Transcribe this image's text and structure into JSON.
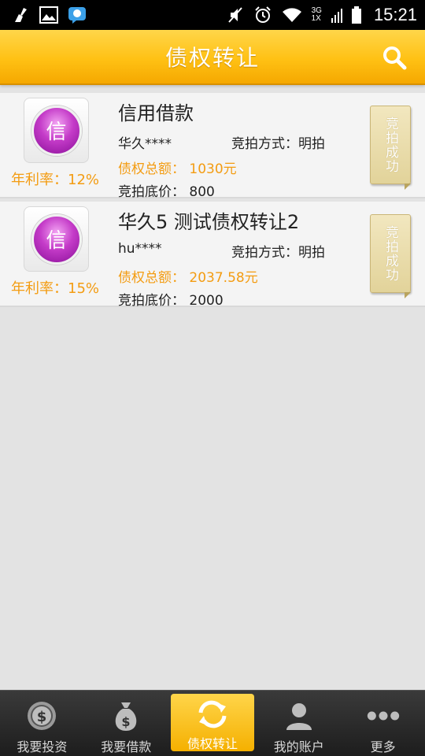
{
  "status_bar": {
    "time": "15:21",
    "net_top": "3G",
    "net_bottom": "1X"
  },
  "header": {
    "title": "债权转让"
  },
  "items": [
    {
      "icon_char": "信",
      "rate": "年利率：12%",
      "title": "信用借款",
      "user": "华久****",
      "method": "竞拍方式：明拍",
      "amount": "债权总额： 1030元",
      "base": "竞拍底价： 800",
      "badge": "竞拍成功"
    },
    {
      "icon_char": "信",
      "rate": "年利率：15%",
      "title": "华久5  测试债权转让2",
      "user": "hu****",
      "method": "竞拍方式：明拍",
      "amount": "债权总额： 2037.58元",
      "base": "竞拍底价： 2000",
      "badge": "竞拍成功"
    }
  ],
  "nav": [
    {
      "label": "我要投资",
      "icon": "dollar-coin-icon"
    },
    {
      "label": "我要借款",
      "icon": "money-bag-icon"
    },
    {
      "label": "债权转让",
      "icon": "refresh-icon",
      "active": true
    },
    {
      "label": "我的账户",
      "icon": "user-icon"
    },
    {
      "label": "更多",
      "icon": "more-dots-icon"
    }
  ],
  "colors": {
    "accent": "#ffc114",
    "rate": "#f39c12",
    "badge": "#e2d39a"
  }
}
